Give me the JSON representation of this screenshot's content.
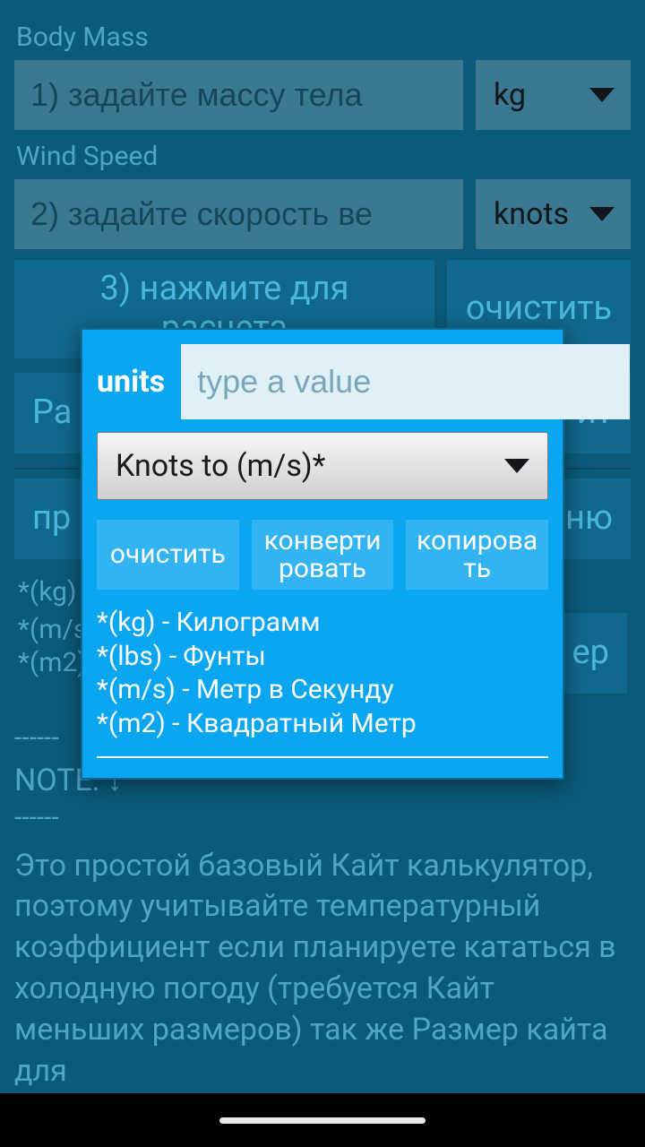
{
  "fields": {
    "body_mass": {
      "label": "Body Mass",
      "placeholder": "1) задайте массу тела",
      "unit": "kg"
    },
    "wind_speed": {
      "label": "Wind Speed",
      "placeholder": "2) задайте скорость ве",
      "unit": "knots"
    }
  },
  "buttons": {
    "calculate": "3) нажмите для расчета",
    "clear": "очистить",
    "row2_left": "Ра",
    "row2_right": "ыло йт",
    "row3_left": "пр",
    "row3_right": "ню",
    "row4_right": "ер"
  },
  "legend_bg": [
    "*(kg) -",
    "*(m/s",
    "*(m2)"
  ],
  "note": {
    "dashes": "------",
    "header": "NOTE: ↓",
    "dashes2": "------",
    "body": "Это простой базовый Кайт калькулятор, поэтому учитывайте температурный коэффициент если планируете кататься в холодную погоду (требуется Кайт меньших размеров) так же Размер кайта для"
  },
  "modal": {
    "label": "units",
    "input_placeholder": "type a value",
    "select_value": "Knots to (m/s)*",
    "buttons": {
      "clear": "очистить",
      "convert": "конверти ровать",
      "copy": "копирова ть"
    },
    "legend": [
      "*(kg) - Килограмм",
      "*(lbs) - Фунты",
      "*(m/s) - Метр в Секунду",
      "*(m2) - Квадратный Метр"
    ]
  }
}
